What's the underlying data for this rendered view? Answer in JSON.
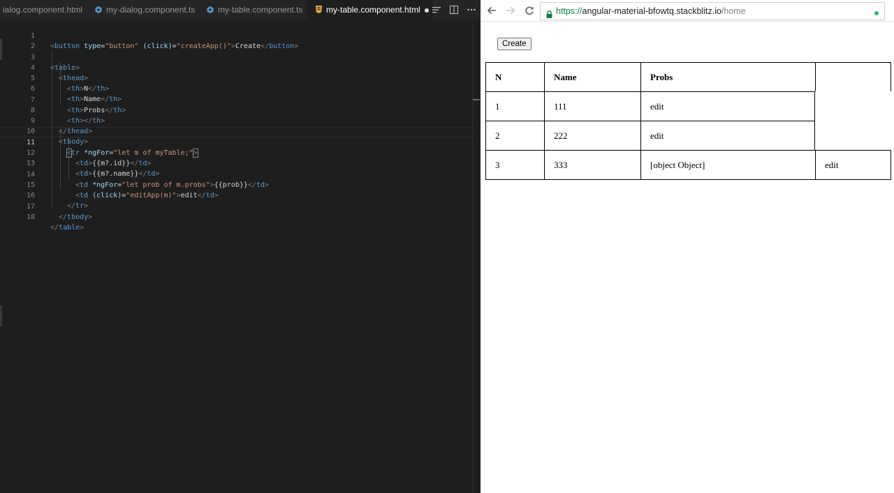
{
  "editor": {
    "tabs": [
      {
        "label": "ialog.component.html",
        "type": "html",
        "active": false
      },
      {
        "label": "my-dialog.component.ts",
        "type": "ts",
        "active": false
      },
      {
        "label": "my-table.component.ts",
        "type": "ts",
        "active": false
      },
      {
        "label": "my-table.component.html",
        "type": "html",
        "active": true,
        "unsaved": true
      }
    ],
    "line_numbers": [
      "1",
      "2",
      "3",
      "4",
      "5",
      "6",
      "7",
      "8",
      "9",
      "10",
      "11",
      "12",
      "13",
      "14",
      "15",
      "16",
      "17",
      "18"
    ],
    "current_line": 11,
    "code": {
      "l1": {
        "o": "<",
        "tag": "button",
        "attr1": "type",
        "eq": "=",
        "val1": "\"button\"",
        "attr2": "(click)",
        "val2": "\"createApp()\"",
        "gt": ">",
        "text": "Create",
        "close": "</",
        "ctag": "button",
        "cgt": ">"
      },
      "l3": {
        "o": "<",
        "tag": "table",
        "gt": ">"
      },
      "l4": {
        "o": "<",
        "tag": "thead",
        "gt": ">"
      },
      "l5": {
        "o": "<",
        "tag": "th",
        "gt": ">",
        "text": "N",
        "close": "</",
        "ctag": "th",
        "cgt": ">"
      },
      "l6": {
        "o": "<",
        "tag": "th",
        "gt": ">",
        "text": "Name",
        "close": "</",
        "ctag": "th",
        "cgt": ">"
      },
      "l7": {
        "o": "<",
        "tag": "th",
        "gt": ">",
        "text": "Probs",
        "close": "</",
        "ctag": "th",
        "cgt": ">"
      },
      "l8": {
        "o": "<",
        "tag": "th",
        "gt": ">",
        "close": "</",
        "ctag": "th",
        "cgt": ">"
      },
      "l9": {
        "close": "</",
        "ctag": "thead",
        "cgt": ">"
      },
      "l10": {
        "o": "<",
        "tag": "tbody",
        "gt": ">"
      },
      "l11": {
        "o": "<",
        "tag": "tr",
        "attr": "*ngFor",
        "eq": "=",
        "val": "\"let m of myTable;\"",
        "gt": ">"
      },
      "l12": {
        "o": "<",
        "tag": "td",
        "gt": ">",
        "text": "{{m?.id}}",
        "close": "</",
        "ctag": "td",
        "cgt": ">"
      },
      "l13": {
        "o": "<",
        "tag": "td",
        "gt": ">",
        "text": "{{m?.name}}",
        "close": "</",
        "ctag": "td",
        "cgt": ">"
      },
      "l14": {
        "o": "<",
        "tag": "td",
        "attr": "*ngFor",
        "eq": "=",
        "val": "\"let prob of m.probs\"",
        "gt": ">",
        "text": "{{prob}}",
        "close": "</",
        "ctag": "td",
        "cgt": ">"
      },
      "l15": {
        "o": "<",
        "tag": "td",
        "attr": "(click)",
        "eq": "=",
        "val": "\"editApp(m)\"",
        "gt": ">",
        "text": "edit",
        "close": "</",
        "ctag": "td",
        "cgt": ">"
      },
      "l16": {
        "close": "</",
        "ctag": "tr",
        "cgt": ">"
      },
      "l17": {
        "close": "</",
        "ctag": "tbody",
        "cgt": ">"
      },
      "l18": {
        "close": "</",
        "ctag": "table",
        "cgt": ">"
      }
    }
  },
  "browser": {
    "url": {
      "protocol": "https://",
      "host": "angular-material-bfowtq.stackblitz.io",
      "path": "/home"
    },
    "icons": {
      "back": "back-arrow-icon",
      "forward": "forward-arrow-icon",
      "reload": "reload-icon",
      "lock": "lock-icon"
    },
    "page": {
      "create_label": "Create",
      "headers": [
        "N",
        "Name",
        "Probs",
        ""
      ],
      "rows": [
        {
          "n": "1",
          "name": "111",
          "probs": [
            "edit"
          ]
        },
        {
          "n": "2",
          "name": "222",
          "probs": [
            "edit"
          ]
        },
        {
          "n": "3",
          "name": "333",
          "probs": [
            "[object Object]",
            "edit"
          ]
        }
      ]
    }
  },
  "colors": {
    "editor_bg": "#1e1e1e",
    "tag": "#569cd6",
    "attr": "#9cdcfe",
    "string": "#ce9178",
    "secure": "#0b8043"
  }
}
